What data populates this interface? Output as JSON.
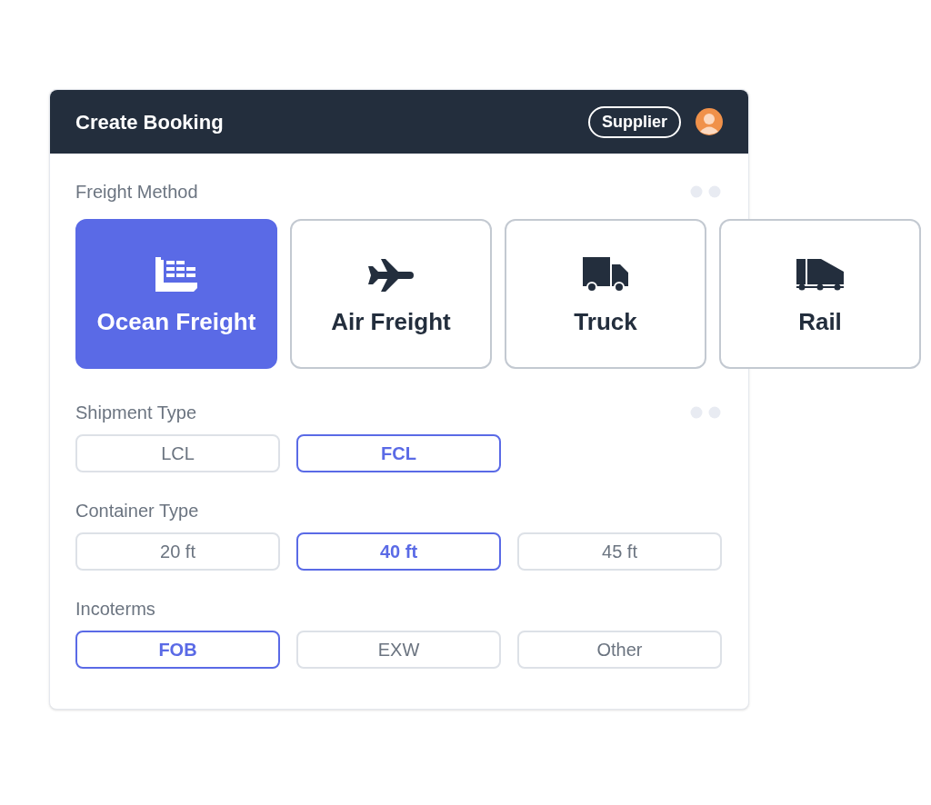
{
  "window": {
    "title": "Create Booking",
    "role_badge": "Supplier"
  },
  "freight_method": {
    "label": "Freight Method",
    "options": [
      {
        "label": "Ocean Freight",
        "kind": "ship",
        "selected": true
      },
      {
        "label": "Air Freight",
        "kind": "plane",
        "selected": false
      },
      {
        "label": "Truck",
        "kind": "truck",
        "selected": false
      },
      {
        "label": "Rail",
        "kind": "rail",
        "selected": false
      }
    ]
  },
  "groups": [
    {
      "label": "Shipment Type",
      "dots": true,
      "options": [
        {
          "label": "LCL",
          "selected": false
        },
        {
          "label": "FCL",
          "selected": true
        }
      ]
    },
    {
      "label": "Container Type",
      "dots": false,
      "options": [
        {
          "label": "20 ft",
          "selected": false
        },
        {
          "label": "40 ft",
          "selected": true
        },
        {
          "label": "45 ft",
          "selected": false
        }
      ]
    },
    {
      "label": "Incoterms",
      "dots": false,
      "options": [
        {
          "label": "FOB",
          "selected": true
        },
        {
          "label": "EXW",
          "selected": false
        },
        {
          "label": "Other",
          "selected": false
        }
      ]
    }
  ]
}
